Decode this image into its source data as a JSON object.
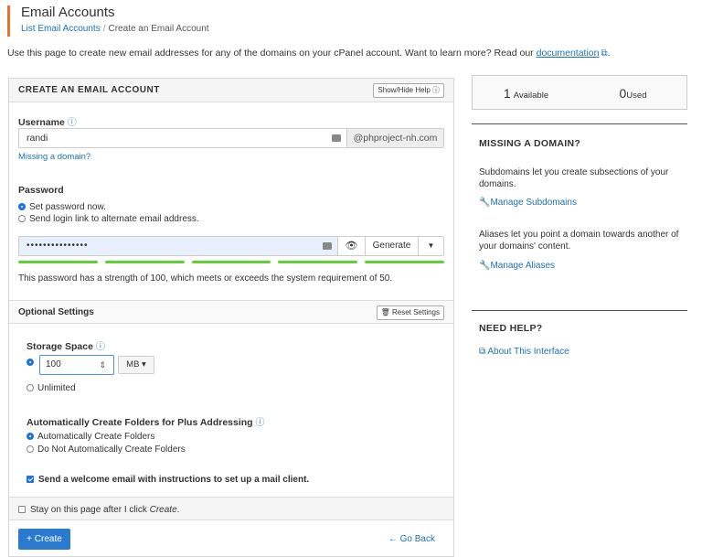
{
  "header": {
    "title": "Email Accounts",
    "breadcrumb_link": "List Email Accounts",
    "breadcrumb_sep": "/",
    "breadcrumb_current": "Create an Email Account"
  },
  "intro": {
    "text": "Use this page to create new email addresses for any of the domains on your cPanel account. Want to learn more? Read our",
    "link": "documentation",
    "end": "."
  },
  "form": {
    "title": "CREATE AN EMAIL ACCOUNT",
    "help_button": "Show/Hide Help ⓘ",
    "username_label": "Username",
    "username_value": "randi",
    "domain": "@phproject-nh.com",
    "missing_domain": "Missing a domain?",
    "password_label": "Password",
    "password_opt1": "Set password now.",
    "password_opt2": "Send login link to alternate email address.",
    "password_value": "•••••••••••••••",
    "generate": "Generate",
    "strength_text": "This password has a strength of 100, which meets or exceeds the system requirement of 50.",
    "optional_title": "Optional Settings",
    "reset_button": "Reset Settings",
    "storage_label": "Storage Space",
    "storage_value": "100",
    "storage_unit": "MB ▾",
    "unlimited": "Unlimited",
    "plus_label": "Automatically Create Folders for Plus Addressing",
    "plus_opt1": "Automatically Create Folders",
    "plus_opt2": "Do Not Automatically Create Folders",
    "welcome": "Send a welcome email with instructions to set up a mail client.",
    "stay_prefix": "Stay on this page after I click ",
    "stay_em": "Create",
    "stay_suffix": ".",
    "create": "+ Create",
    "go_back": "← Go Back"
  },
  "sidebar": {
    "available_num": "1",
    "available_label": "Available",
    "used_num": "0",
    "used_label": "Used",
    "missing_title": "MISSING A DOMAIN?",
    "sub_text": "Subdomains let you create subsections of your domains.",
    "sub_link": "Manage Subdomains",
    "alias_text": "Aliases let you point a domain towards another of your domains' content.",
    "alias_link": "Manage Aliases",
    "help_title": "NEED HELP?",
    "help_link": "About This Interface"
  }
}
